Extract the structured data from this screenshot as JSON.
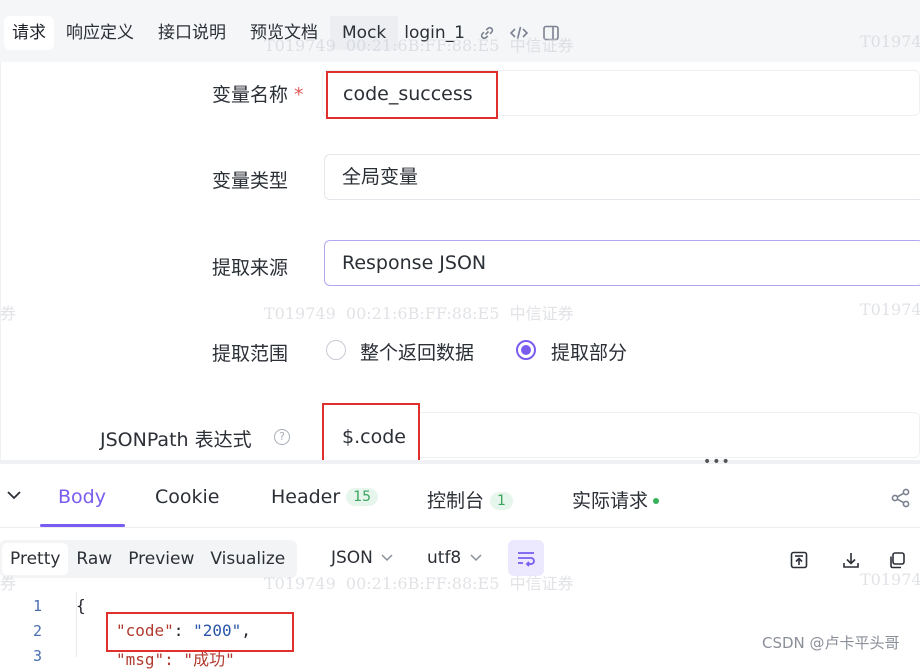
{
  "top_tabs": {
    "request": "请求",
    "response_def": "响应定义",
    "api_doc": "接口说明",
    "preview_doc": "预览文档",
    "mock": "Mock",
    "api_name": "login_1",
    "icons": [
      "link-icon",
      "code-icon",
      "panel-icon"
    ]
  },
  "form": {
    "variable_name": {
      "label": "变量名称",
      "required_mark": "*",
      "value": "code_success"
    },
    "variable_type": {
      "label": "变量类型",
      "value": "全局变量"
    },
    "extract_source": {
      "label": "提取来源",
      "value": "Response JSON"
    },
    "extract_range": {
      "label": "提取范围",
      "options": [
        {
          "label": "整个返回数据",
          "selected": false
        },
        {
          "label": "提取部分",
          "selected": true
        }
      ]
    },
    "jsonpath": {
      "label": "JSONPath 表达式",
      "help_icon": "help-circle-icon",
      "value": "$.code"
    }
  },
  "response_tabs": {
    "body": "Body",
    "cookie": "Cookie",
    "header": "Header",
    "header_count": "15",
    "console": "控制台",
    "console_count": "1",
    "actual_request": "实际请求"
  },
  "body_toolbar": {
    "views": [
      "Pretty",
      "Raw",
      "Preview",
      "Visualize"
    ],
    "active_view": "Pretty",
    "format": "JSON",
    "encoding": "utf8"
  },
  "code": {
    "lines": [
      {
        "num": "1",
        "text": "{"
      },
      {
        "num": "2",
        "key": "\"code\"",
        "sep": ": ",
        "val": "\"200\"",
        "tail": ","
      },
      {
        "num": "3",
        "text": "\"msg\": \"成功\""
      }
    ]
  },
  "watermark": {
    "id": "T019749",
    "mac": "00:21:6B:FF:88:E5",
    "company": "中信证券",
    "partial": "券"
  },
  "credit": "CSDN @卢卡平头哥",
  "colors": {
    "accent": "#7a5cf0",
    "highlight_box": "#e0302e",
    "badge_green": "#3aa35c"
  }
}
